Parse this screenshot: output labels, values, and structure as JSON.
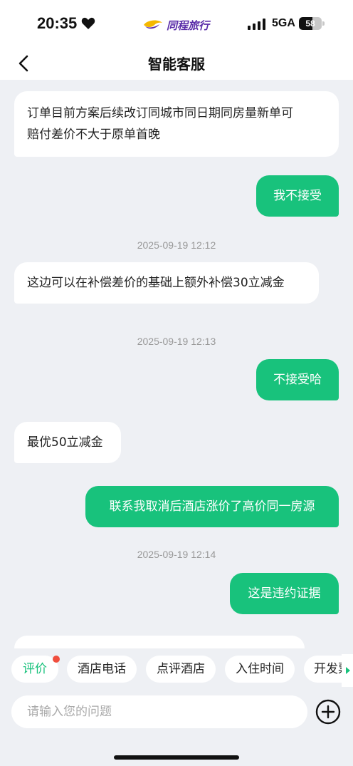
{
  "status_bar": {
    "time": "20:35",
    "brand": "同程旅行",
    "network": "5GA",
    "battery_level": "58",
    "battery_fraction": 0.58
  },
  "header": {
    "title": "智能客服"
  },
  "messages": [
    {
      "sender": "agent",
      "text_line1": "订单目前方案后续改订同城市同日期同房量新单可",
      "text_line2": "赔付差价不大于原单首晚"
    },
    {
      "sender": "user",
      "text": "我不接受"
    },
    {
      "type": "timestamp",
      "text": "2025-09-19 12:12"
    },
    {
      "sender": "agent",
      "text": "这边可以在补偿差价的基础上额外补偿30立减金"
    },
    {
      "type": "timestamp",
      "text": "2025-09-19 12:13"
    },
    {
      "sender": "user",
      "text": "不接受哈"
    },
    {
      "sender": "agent",
      "text": "最优50立减金"
    },
    {
      "sender": "user",
      "text": "联系我取消后酒店涨价了高价同一房源"
    },
    {
      "type": "timestamp",
      "text": "2025-09-19 12:14"
    },
    {
      "sender": "user",
      "text": "这是违约证据"
    }
  ],
  "quick_replies": [
    "评价",
    "酒店电话",
    "点评酒店",
    "入住时间",
    "开发票"
  ],
  "input": {
    "placeholder": "请输入您的问题"
  },
  "colors": {
    "accent_green": "#18c27c",
    "badge_red": "#f04e3e",
    "brand_purple": "#5a2ca8"
  }
}
